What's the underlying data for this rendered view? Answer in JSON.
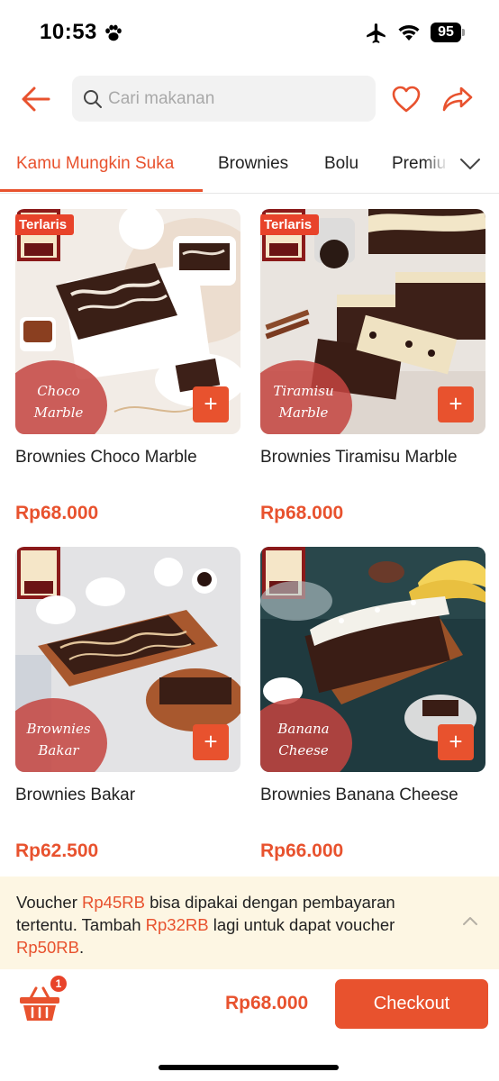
{
  "status_bar": {
    "time": "10:53",
    "battery": "95"
  },
  "header": {
    "search_placeholder": "Cari makanan"
  },
  "tabs": [
    {
      "label": "Kamu Mungkin Suka",
      "active": true
    },
    {
      "label": "Brownies",
      "active": false
    },
    {
      "label": "Bolu",
      "active": false
    },
    {
      "label": "Premiu",
      "active": false
    }
  ],
  "products": [
    {
      "name": "Brownies Choco Marble",
      "price": "Rp68.000",
      "badge": "Terlaris",
      "flavor_line1": "Choco",
      "flavor_line2": "Marble"
    },
    {
      "name": "Brownies Tiramisu Marble",
      "price": "Rp68.000",
      "badge": "Terlaris",
      "flavor_line1": "Tiramisu",
      "flavor_line2": "Marble"
    },
    {
      "name": "Brownies Bakar",
      "price": "Rp62.500",
      "badge": "",
      "flavor_line1": "Brownies",
      "flavor_line2": "Bakar"
    },
    {
      "name": "Brownies Banana Cheese",
      "price": "Rp66.000",
      "badge": "",
      "flavor_line1": "Banana",
      "flavor_line2": "Cheese"
    }
  ],
  "voucher": {
    "part1": "Voucher ",
    "amount1": "Rp45RB",
    "part2": " bisa dipakai dengan pembayaran tertentu. Tambah ",
    "amount2": "Rp32RB",
    "part3": " lagi untuk dapat voucher ",
    "amount3": "Rp50RB",
    "part4": "."
  },
  "cart": {
    "count": "1",
    "total": "Rp68.000",
    "checkout_label": "Checkout"
  },
  "colors": {
    "accent": "#e8522e",
    "badge": "#e8432a",
    "voucher_bg": "#fdf6e3"
  },
  "icons": [
    "paw-icon",
    "airplane-icon",
    "wifi-icon",
    "battery-icon",
    "back-arrow-icon",
    "search-icon",
    "heart-icon",
    "share-icon",
    "chevron-down-icon",
    "plus-icon",
    "chevron-up-icon",
    "basket-icon"
  ]
}
